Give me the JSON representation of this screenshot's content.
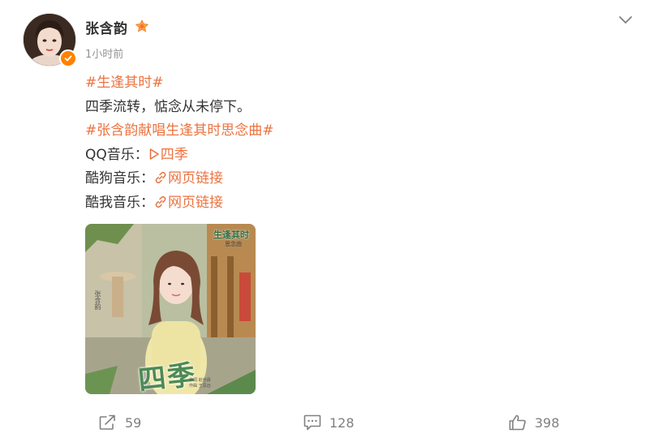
{
  "user": {
    "name": "张含韵",
    "time": "1小时前"
  },
  "content": {
    "tag1": "#生逢其时#",
    "text": "四季流转，惦念从未停下。",
    "tag2": "#张含韵献唱生逢其时思念曲#",
    "qq_label": "QQ音乐：",
    "qq_link": "四季",
    "kugou_label": "酷狗音乐：",
    "kugou_link": "网页链接",
    "kuwo_label": "酷我音乐：",
    "kuwo_link": "网页链接"
  },
  "cover": {
    "title": "四季",
    "logo": "生逢其时",
    "subtitle": "思念曲",
    "side_text": "张含韵",
    "credit_1": "作词 赵佳霖",
    "credit_2": "作曲 王思远"
  },
  "actions": {
    "repost_count": "59",
    "comment_count": "128",
    "like_count": "398"
  },
  "colors": {
    "link": "#eb7340",
    "text": "#333333",
    "meta": "#939393",
    "verified": "#ff8200"
  },
  "icons": [
    "chevron-down-icon",
    "verified-icon",
    "fan-badge-icon",
    "play-icon",
    "link-icon",
    "repost-icon",
    "comment-icon",
    "like-icon"
  ]
}
